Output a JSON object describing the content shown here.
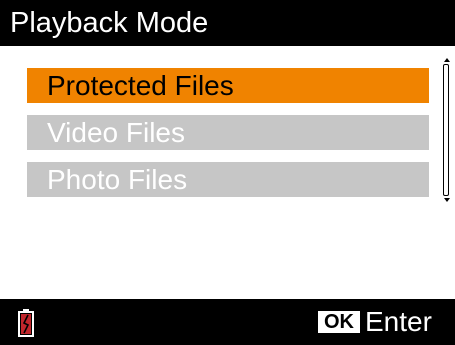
{
  "header": {
    "title": "Playback Mode"
  },
  "menu": {
    "items": [
      {
        "label": "Protected Files",
        "selected": true
      },
      {
        "label": "Video Files",
        "selected": false
      },
      {
        "label": "Photo Files",
        "selected": false
      }
    ]
  },
  "footer": {
    "battery_icon": "battery-low-icon",
    "ok_badge": "OK",
    "enter_label": "Enter"
  },
  "colors": {
    "header_bg": "#000000",
    "selected_bg": "#f08300",
    "unselected_bg": "#c6c6c6",
    "battery_level": "#c0262c"
  }
}
